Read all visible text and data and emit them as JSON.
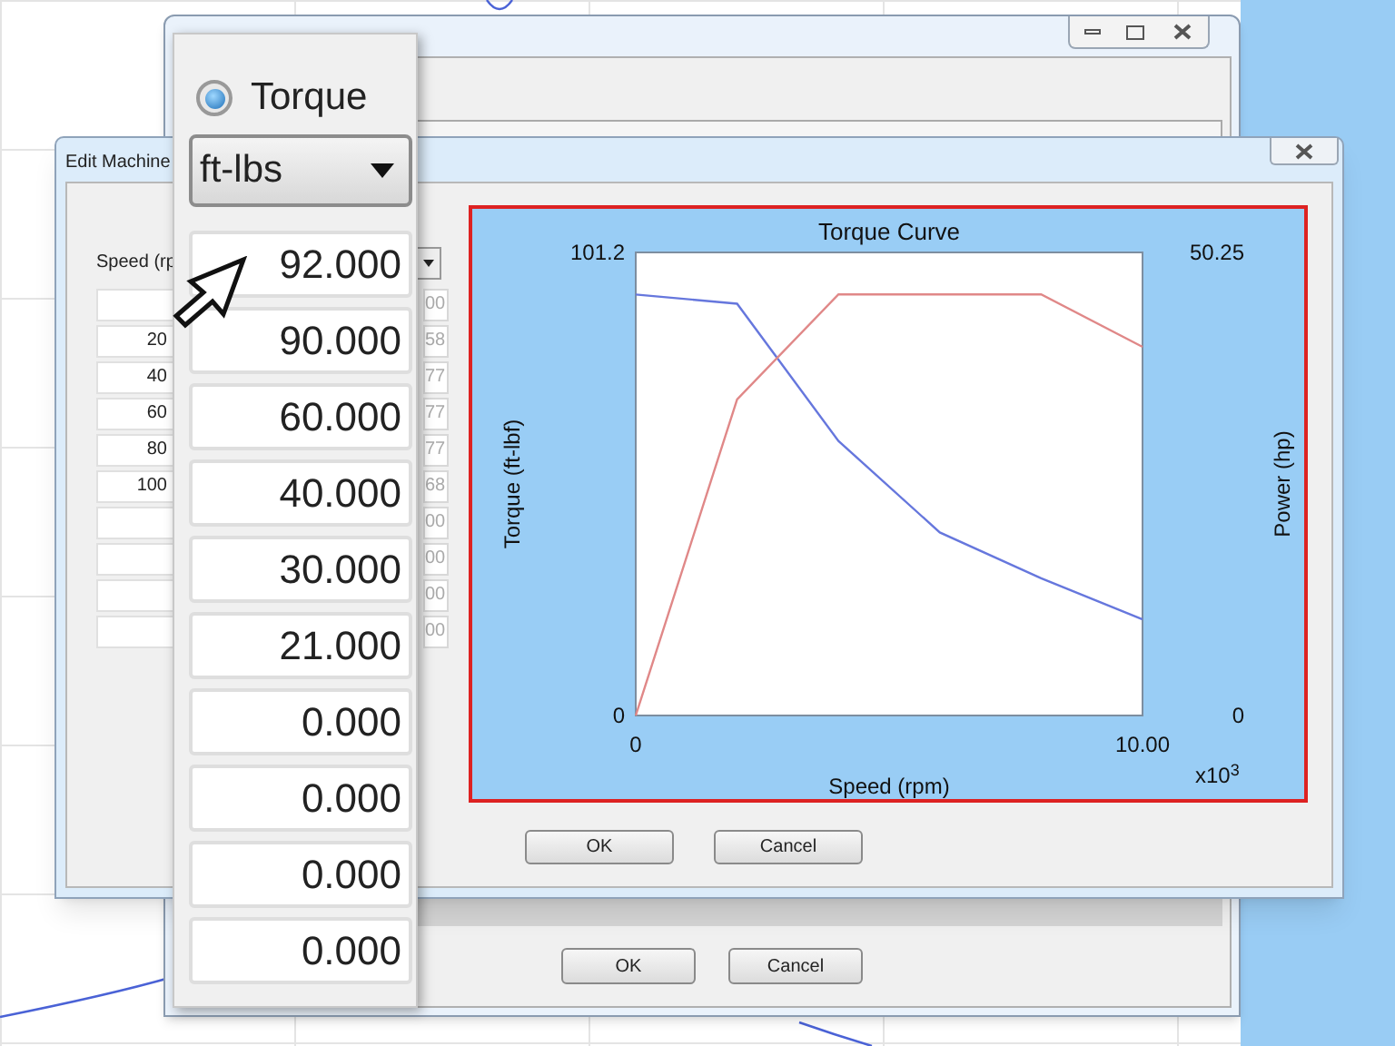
{
  "background_window": {
    "buttons": [
      "OK",
      "Cancel"
    ]
  },
  "edit_window": {
    "title": "Edit Machine",
    "column_header": "Speed (rp",
    "rows": [
      {
        "col_2": "00"
      },
      {
        "speed": "20",
        "col_2": "58"
      },
      {
        "speed": "40",
        "col_2": "77"
      },
      {
        "speed": "60",
        "col_2": "77"
      },
      {
        "speed": "80",
        "col_2": "77"
      },
      {
        "speed": "100",
        "col_2": "68"
      },
      {
        "col_2": "00"
      },
      {
        "col_2": "00"
      },
      {
        "col_2": "00"
      },
      {
        "col_2": "00"
      }
    ],
    "chart_data": {
      "type": "line",
      "title": "Torque Curve",
      "xlabel": "Speed (rpm)",
      "ylabel": "Torque (ft-lbf)",
      "x": [
        0,
        2,
        4,
        6,
        8,
        10
      ],
      "xlim": [
        0,
        10
      ],
      "ylim": [
        0,
        101.2
      ],
      "xticks": [
        0,
        {
          "value": 10,
          "label": "10.00"
        }
      ],
      "yticks": [
        0,
        {
          "value": 101.2,
          "label": "101.2"
        }
      ],
      "series": [
        {
          "color": "#6677dd",
          "values": [
            92,
            90,
            60,
            40,
            30,
            21
          ]
        },
        {
          "color": "#e08888",
          "axis": "y2",
          "values": [
            0,
            34.3,
            45.7,
            45.7,
            45.7,
            40.0
          ]
        }
      ],
      "y2label": "Power (hp)",
      "y2lim": [
        0,
        50.25
      ],
      "y2ticks": [
        0,
        {
          "value": 50.25,
          "label": "50.25"
        }
      ],
      "annotations": [
        {
          "text": "x10$^{3}$"
        }
      ]
    },
    "buttons": [
      "OK",
      "Cancel"
    ]
  },
  "magnifier": {
    "radio": {
      "label": "Torque",
      "selected": true
    },
    "unit_dropdown": {
      "value": "ft-lbs"
    },
    "values": [
      "92.000",
      "90.000",
      "60.000",
      "40.000",
      "30.000",
      "21.000",
      "0.000",
      "0.000",
      "0.000",
      "0.000"
    ]
  }
}
